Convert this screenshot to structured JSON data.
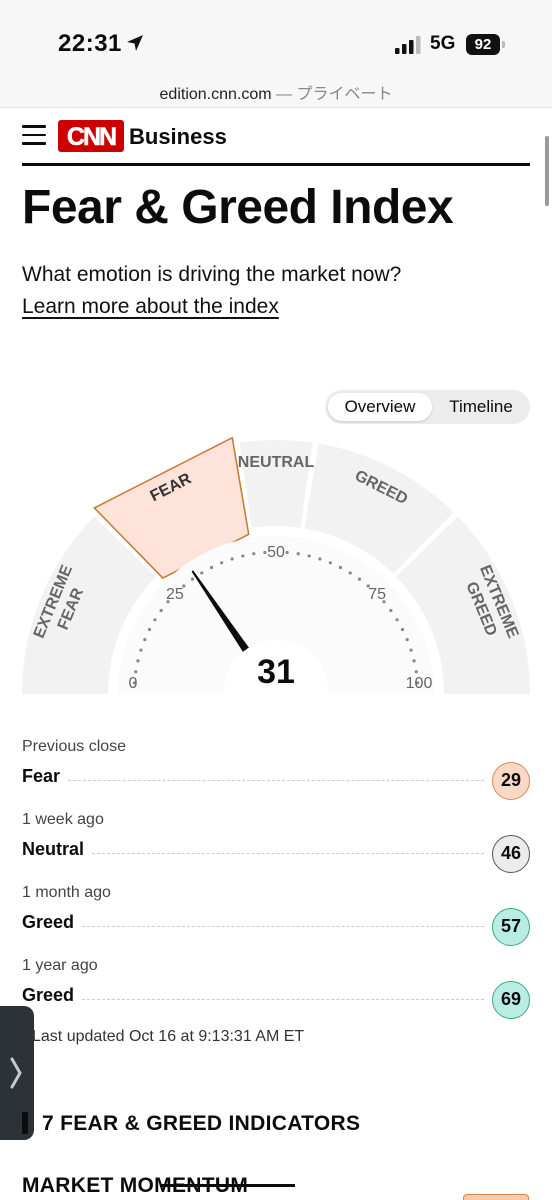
{
  "status_bar": {
    "time": "22:31",
    "network": "5G",
    "battery": "92"
  },
  "url_bar": {
    "domain": "edition.cnn.com",
    "mode": " — プライベート"
  },
  "header": {
    "logo_text": "CNN",
    "section": "Business",
    "icons": [
      "menu-icon",
      "cnn-logo",
      "location-arrow-icon",
      "signal-icon",
      "battery-icon",
      "chevron-right-icon"
    ]
  },
  "page": {
    "title": "Fear & Greed Index",
    "subtitle": "What emotion is driving the market now?",
    "learn_more": "Learn more about the index"
  },
  "view_toggle": {
    "options": [
      "Overview",
      "Timeline"
    ],
    "selected": "Overview"
  },
  "gauge": {
    "value": 31,
    "min": 0,
    "max": 100,
    "tick_labels": [
      "0",
      "25",
      "50",
      "75",
      "100"
    ],
    "segments": [
      {
        "label": "EXTREME FEAR",
        "lines": [
          "EXTREME",
          "FEAR"
        ],
        "range": [
          0,
          25
        ]
      },
      {
        "label": "FEAR",
        "lines": [
          "FEAR"
        ],
        "range": [
          25,
          45
        ]
      },
      {
        "label": "NEUTRAL",
        "lines": [
          "NEUTRAL"
        ],
        "range": [
          45,
          55
        ]
      },
      {
        "label": "GREED",
        "lines": [
          "GREED"
        ],
        "range": [
          55,
          75
        ]
      },
      {
        "label": "EXTREME GREED",
        "lines": [
          "EXTREME",
          "GREED"
        ],
        "range": [
          75,
          100
        ]
      }
    ],
    "active_segment": "FEAR",
    "colors": {
      "band": "#f2f2f2",
      "active_fill": "#fde3da",
      "active_stroke": "#c4792e",
      "label": "#666666",
      "needle": "#0c0c0c"
    }
  },
  "history": [
    {
      "when": "Previous close",
      "rating": "Fear",
      "value": "29",
      "color": "#f9d9c6",
      "border": "#d58a52"
    },
    {
      "when": "1 week ago",
      "rating": "Neutral",
      "value": "46",
      "color": "#ececec",
      "border": "#555555"
    },
    {
      "when": "1 month ago",
      "rating": "Greed",
      "value": "57",
      "color": "#b9ece2",
      "border": "#3aa890"
    },
    {
      "when": "1 year ago",
      "rating": "Greed",
      "value": "69",
      "color": "#b9ece2",
      "border": "#3aa890"
    }
  ],
  "last_updated": "Last updated Oct 16 at 9:13:31 AM ET",
  "indicators": {
    "title": "7 FEAR & GREED INDICATORS",
    "first_section": "MARKET MOMENTUM"
  }
}
